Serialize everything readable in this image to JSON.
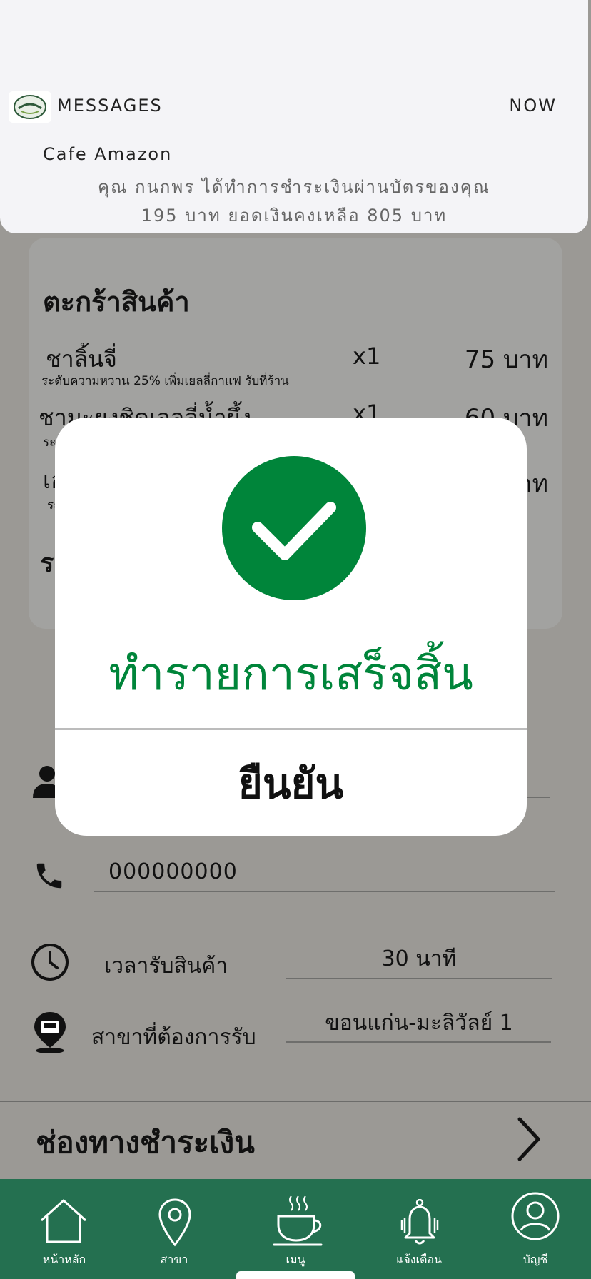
{
  "notification": {
    "app_name": "MESSAGES",
    "time": "NOW",
    "title": "Cafe Amazon",
    "body_line1": "คุณ กนกพร ได้ทำการชำระเงินผ่านบัตรของคุณ",
    "body_line2": "195 บาท ยอดเงินคงเหลือ 805 บาท",
    "icon": "cafe-amazon-logo"
  },
  "cart": {
    "title": "ตะกร้าสินค้า",
    "items": [
      {
        "name": "ชาลิ้นจี่",
        "qty": "x1",
        "price": "75 บาท",
        "note": "ระดับความหวาน 25% เพิ่มเยลลี่กาแฟ รับที่ร้าน"
      },
      {
        "name": "ชามะยงชิดเจลลี่น้ำผึ้ง",
        "qty": "x1",
        "price": "60 บาท",
        "note": "ระ"
      },
      {
        "name": "เอ",
        "qty": "",
        "price": "าท",
        "note": "ระ"
      }
    ],
    "partial_label": "ร"
  },
  "form": {
    "phone_value": "000000000",
    "pickup_time_label": "เวลารับสินค้า",
    "pickup_time_value": "30 นาที",
    "branch_label": "สาขาที่ต้องการรับ",
    "branch_value": "ขอนแก่น-มะลิวัลย์ 1"
  },
  "payment": {
    "label": "ช่องทางชำระเงิน"
  },
  "modal": {
    "title": "ทำรายการเสร็จสิ้น",
    "confirm_label": "ยืนยัน",
    "accent": "#00853a"
  },
  "tabbar": {
    "background": "#247050",
    "tabs": [
      {
        "label": "หน้าหลัก",
        "icon": "home-icon"
      },
      {
        "label": "สาขา",
        "icon": "location-pin-icon"
      },
      {
        "label": "เมนู",
        "icon": "coffee-cup-icon"
      },
      {
        "label": "แจ้งเตือน",
        "icon": "bell-icon"
      },
      {
        "label": "บัญชี",
        "icon": "account-icon"
      }
    ]
  }
}
